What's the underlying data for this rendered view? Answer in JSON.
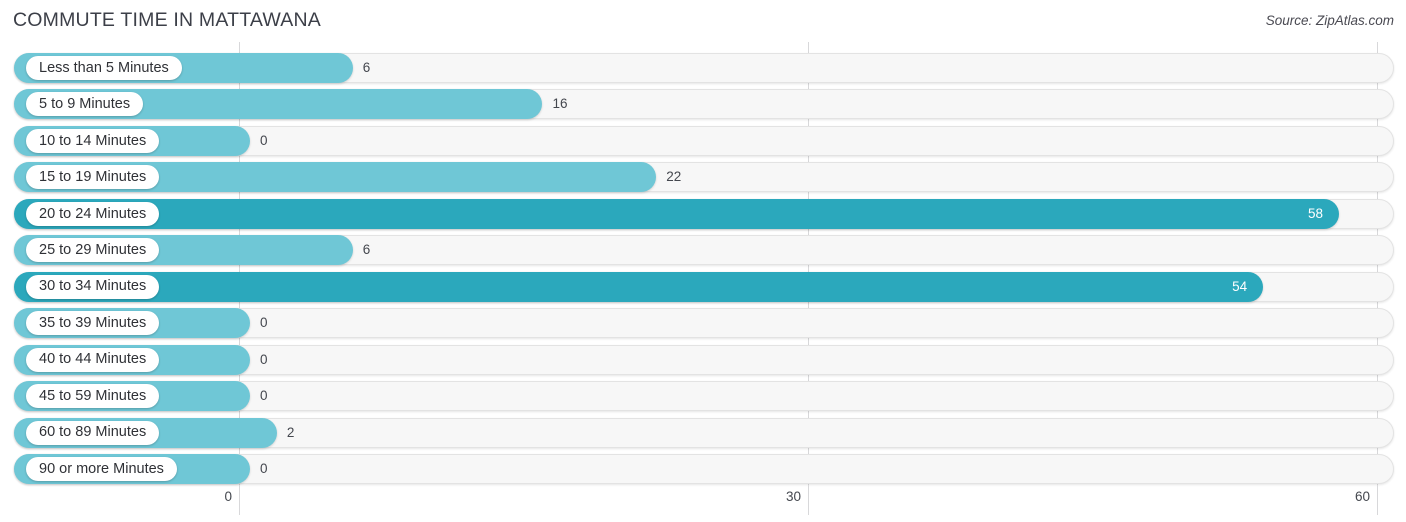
{
  "header": {
    "title": "COMMUTE TIME IN MATTAWANA",
    "source": "Source: ZipAtlas.com"
  },
  "colors": {
    "bar_light": "#6FC7D6",
    "bar_dark": "#2BA8BC",
    "track": "#F7F7F7",
    "gridline": "#D8D8DA",
    "text": "#44474E"
  },
  "chart_data": {
    "type": "bar",
    "orientation": "horizontal",
    "title": "COMMUTE TIME IN MATTAWANA",
    "xlabel": "",
    "ylabel": "",
    "xlim": [
      0,
      60
    ],
    "ticks": [
      "0",
      "30",
      "60"
    ],
    "tick_values": [
      0,
      30,
      60
    ],
    "grid": true,
    "legend": false,
    "categories": [
      "Less than 5 Minutes",
      "5 to 9 Minutes",
      "10 to 14 Minutes",
      "15 to 19 Minutes",
      "20 to 24 Minutes",
      "25 to 29 Minutes",
      "30 to 34 Minutes",
      "35 to 39 Minutes",
      "40 to 44 Minutes",
      "45 to 59 Minutes",
      "60 to 89 Minutes",
      "90 or more Minutes"
    ],
    "values": [
      6,
      16,
      0,
      22,
      58,
      6,
      54,
      0,
      0,
      0,
      2,
      0
    ],
    "labels": [
      "6",
      "16",
      "0",
      "22",
      "58",
      "6",
      "54",
      "0",
      "0",
      "0",
      "2",
      "0"
    ]
  },
  "rows": [
    {
      "label": "Less than 5 Minutes",
      "value": 6,
      "value_label": "6",
      "shade": "light",
      "inside": false
    },
    {
      "label": "5 to 9 Minutes",
      "value": 16,
      "value_label": "16",
      "shade": "light",
      "inside": false
    },
    {
      "label": "10 to 14 Minutes",
      "value": 0,
      "value_label": "0",
      "shade": "light",
      "inside": false
    },
    {
      "label": "15 to 19 Minutes",
      "value": 22,
      "value_label": "22",
      "shade": "light",
      "inside": false
    },
    {
      "label": "20 to 24 Minutes",
      "value": 58,
      "value_label": "58",
      "shade": "dark",
      "inside": true
    },
    {
      "label": "25 to 29 Minutes",
      "value": 6,
      "value_label": "6",
      "shade": "light",
      "inside": false
    },
    {
      "label": "30 to 34 Minutes",
      "value": 54,
      "value_label": "54",
      "shade": "dark",
      "inside": true
    },
    {
      "label": "35 to 39 Minutes",
      "value": 0,
      "value_label": "0",
      "shade": "light",
      "inside": false
    },
    {
      "label": "40 to 44 Minutes",
      "value": 0,
      "value_label": "0",
      "shade": "light",
      "inside": false
    },
    {
      "label": "45 to 59 Minutes",
      "value": 0,
      "value_label": "0",
      "shade": "light",
      "inside": false
    },
    {
      "label": "60 to 89 Minutes",
      "value": 2,
      "value_label": "2",
      "shade": "light",
      "inside": false
    },
    {
      "label": "90 or more Minutes",
      "value": 0,
      "value_label": "0",
      "shade": "light",
      "inside": false
    }
  ]
}
